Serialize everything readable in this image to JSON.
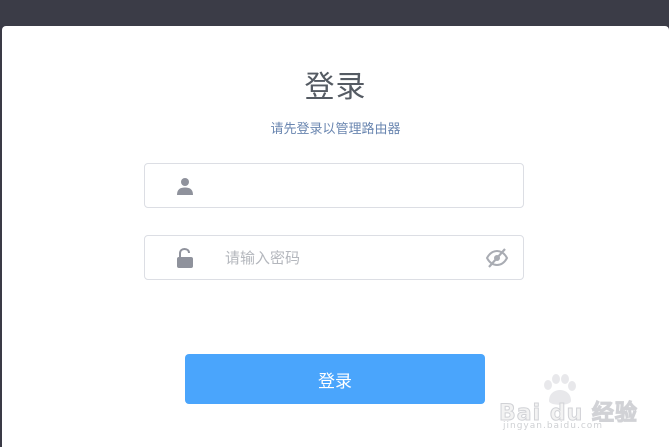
{
  "dialog": {
    "title": "登录",
    "subtitle": "请先登录以管理路由器"
  },
  "username": {
    "value": "",
    "placeholder": "",
    "icon": "user-icon"
  },
  "password": {
    "value": "",
    "placeholder": "请输入密码",
    "icon": "lock-icon",
    "toggle_icon": "eye-off-icon"
  },
  "login_button": {
    "label": "登录"
  },
  "watermark": {
    "brand": "Bai du 经验",
    "url": "jingyan.baidu.com"
  },
  "colors": {
    "top_bar": "#3b3c47",
    "button": "#4aa5fc",
    "subtitle": "#6a86b0",
    "title": "#555b63"
  }
}
